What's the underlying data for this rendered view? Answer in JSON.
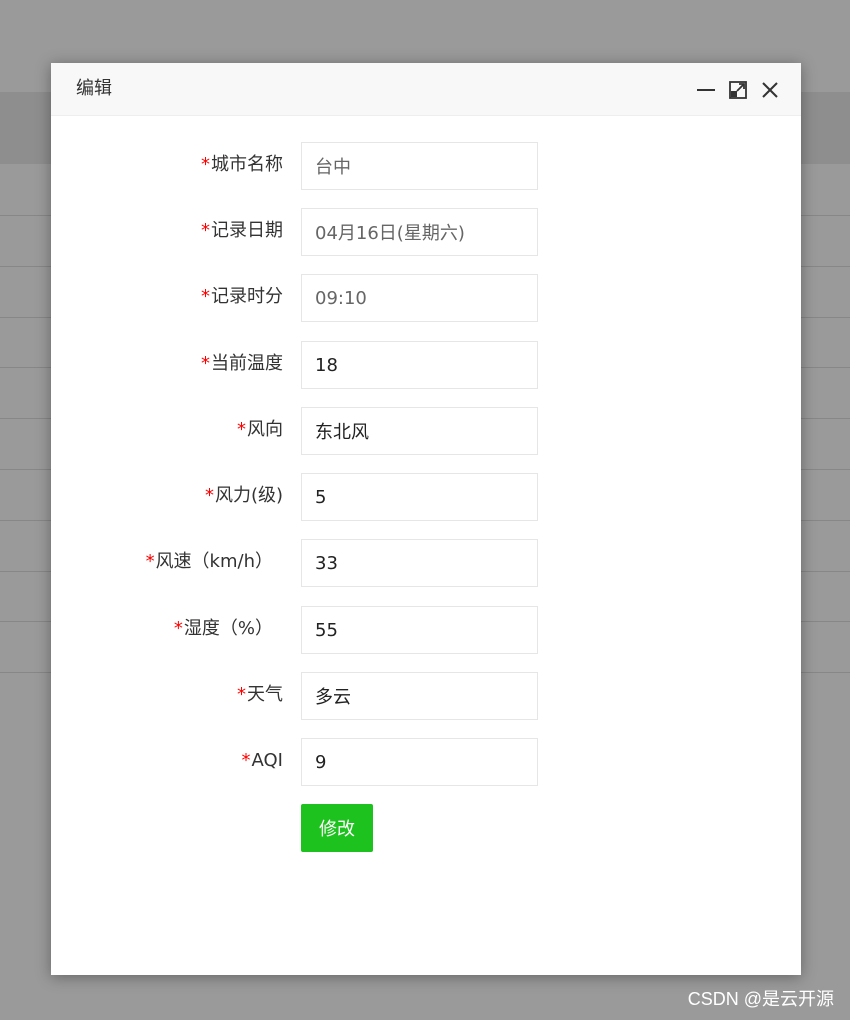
{
  "dialog": {
    "title": "编辑",
    "submit_label": "修改"
  },
  "form": {
    "fields": [
      {
        "required_mark": "*",
        "label": "城市名称",
        "value": "台中"
      },
      {
        "required_mark": "*",
        "label": "记录日期",
        "value": "04月16日(星期六)"
      },
      {
        "required_mark": "*",
        "label": "记录时分",
        "value": "09:10"
      },
      {
        "required_mark": "*",
        "label": "当前温度",
        "value": "18"
      },
      {
        "required_mark": "*",
        "label": "风向",
        "value": "东北风"
      },
      {
        "required_mark": "*",
        "label": "风力(级)",
        "value": "5"
      },
      {
        "required_mark": "*",
        "label": "风速（km/h）",
        "value": "33"
      },
      {
        "required_mark": "*",
        "label": "湿度（%）",
        "value": "55"
      },
      {
        "required_mark": "*",
        "label": "天气",
        "value": "多云"
      },
      {
        "required_mark": "*",
        "label": "AQI",
        "value": "9"
      }
    ]
  },
  "icons": {
    "minimize": "minimize-icon",
    "maximize": "maximize-icon",
    "close": "close-icon"
  },
  "colors": {
    "required": "#ff0000",
    "submit_bg": "#1ec21e",
    "overlay": "#8f8f8f"
  },
  "watermark": "CSDN @是云开源"
}
